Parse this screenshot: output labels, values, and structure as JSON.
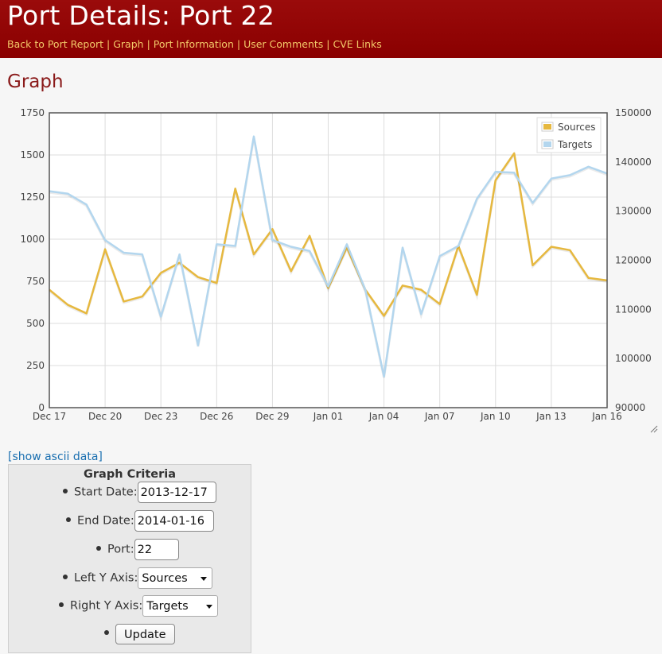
{
  "header": {
    "title": "Port Details: Port 22",
    "nav": [
      "Back to Port Report",
      "Graph",
      "Port Information",
      "User Comments",
      "CVE Links"
    ],
    "nav_separator": "|",
    "background": "#8d0000",
    "nav_color": "#f3c969"
  },
  "section": {
    "title": "Graph"
  },
  "chart_data": {
    "type": "line",
    "x_tick_labels": [
      "Dec 17",
      "Dec 20",
      "Dec 23",
      "Dec 26",
      "Dec 29",
      "Jan 01",
      "Jan 04",
      "Jan 07",
      "Jan 10",
      "Jan 13",
      "Jan 16"
    ],
    "x": [
      "2013-12-17",
      "2013-12-18",
      "2013-12-19",
      "2013-12-20",
      "2013-12-21",
      "2013-12-22",
      "2013-12-23",
      "2013-12-24",
      "2013-12-25",
      "2013-12-26",
      "2013-12-27",
      "2013-12-28",
      "2013-12-29",
      "2013-12-30",
      "2013-12-31",
      "2014-01-01",
      "2014-01-02",
      "2014-01-03",
      "2014-01-04",
      "2014-01-05",
      "2014-01-06",
      "2014-01-07",
      "2014-01-08",
      "2014-01-09",
      "2014-01-10",
      "2014-01-11",
      "2014-01-12",
      "2014-01-13",
      "2014-01-14",
      "2014-01-15",
      "2014-01-16"
    ],
    "y_left_ticks": [
      "0",
      "250",
      "500",
      "750",
      "1000",
      "1250",
      "1500",
      "1750"
    ],
    "y_left_range": [
      0,
      1750
    ],
    "y_right_ticks": [
      "90000",
      "100000",
      "110000",
      "120000",
      "130000",
      "140000",
      "150000"
    ],
    "y_right_range": [
      90000,
      150000
    ],
    "grid": true,
    "legend_position": "top-right",
    "series": [
      {
        "name": "Sources",
        "axis": "left",
        "color": "#e6b83f",
        "values": [
          700,
          610,
          560,
          940,
          630,
          660,
          800,
          860,
          775,
          740,
          1300,
          910,
          1060,
          810,
          1020,
          710,
          950,
          700,
          545,
          725,
          700,
          615,
          960,
          670,
          1350,
          1510,
          845,
          955,
          935,
          770,
          755
        ]
      },
      {
        "name": "Targets",
        "axis": "left",
        "color": "#b3d6ee",
        "values": [
          1285,
          1270,
          1205,
          995,
          920,
          910,
          540,
          910,
          370,
          970,
          960,
          1610,
          995,
          955,
          930,
          720,
          970,
          700,
          185,
          950,
          555,
          900,
          960,
          1240,
          1400,
          1395,
          1215,
          1360,
          1380,
          1430,
          1390
        ]
      }
    ]
  },
  "ascii_link": "[show ascii data]",
  "criteria": {
    "title": "Graph Criteria",
    "start_date": {
      "label": "Start Date:",
      "value": "2013-12-17"
    },
    "end_date": {
      "label": "End Date:",
      "value": "2014-01-16"
    },
    "port": {
      "label": "Port:",
      "value": "22"
    },
    "left_axis": {
      "label": "Left Y Axis:",
      "value": "Sources"
    },
    "right_axis": {
      "label": "Right Y Axis:",
      "value": "Targets"
    },
    "update_label": "Update"
  }
}
